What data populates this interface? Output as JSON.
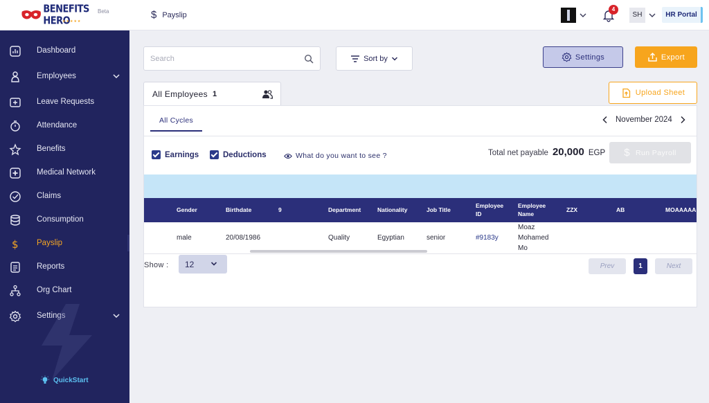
{
  "header": {
    "brand": "BENEFITS HERO",
    "beta": "Beta",
    "page": "Payslip",
    "notifications_count": "4",
    "user_initials": "SH",
    "portal": "HR Portal"
  },
  "sidebar": {
    "items": [
      {
        "label": "Dashboard",
        "icon": "dashboard-icon"
      },
      {
        "label": "Employees",
        "icon": "person-icon"
      },
      {
        "label": "Leave Requests",
        "icon": "leave-icon"
      },
      {
        "label": "Attendance",
        "icon": "stopwatch-icon"
      },
      {
        "label": "Benefits",
        "icon": "star-icon"
      },
      {
        "label": "Medical Network",
        "icon": "medical-icon"
      },
      {
        "label": "Claims",
        "icon": "check-circle-icon"
      },
      {
        "label": "Consumption",
        "icon": "database-icon"
      },
      {
        "label": "Payslip",
        "icon": "dollar-icon"
      },
      {
        "label": "Reports",
        "icon": "report-icon"
      },
      {
        "label": "Org Chart",
        "icon": "org-chart-icon"
      },
      {
        "label": "Settings",
        "icon": "gear-icon"
      }
    ],
    "quickstart": "QuickStart"
  },
  "toolbar": {
    "search_placeholder": "Search",
    "sort_label": "Sort by",
    "settings_label": "Settings",
    "export_label": "Export",
    "upload_label": "Upload Sheet"
  },
  "tabs": {
    "employees_label": "All Employees",
    "employees_count": "1",
    "cycles_label": "All Cycles"
  },
  "period": {
    "month": "November 2024"
  },
  "filters": {
    "earnings": "Earnings",
    "deductions": "Deductions",
    "what_see": "What do you want to see ?"
  },
  "summary": {
    "label": "Total net payable",
    "value": "20,000",
    "currency": "EGP",
    "run_label": "Run Payroll"
  },
  "table": {
    "columns": [
      "Gender",
      "Birthdate",
      "9",
      "Department",
      "Nationality",
      "Job Title",
      "Employee ID",
      "Employee Name",
      "ZZX",
      "AB",
      "MOAAAAA"
    ],
    "row": [
      "male",
      "20/08/1986",
      "",
      "Quality",
      "Egyptian",
      "senior",
      "#9183y",
      "Moaz Mohamed Mo",
      "",
      "",
      ""
    ]
  },
  "pagination": {
    "show_label": "Show :",
    "page_size": "12",
    "prev": "Prev",
    "page": "1",
    "next": "Next"
  }
}
